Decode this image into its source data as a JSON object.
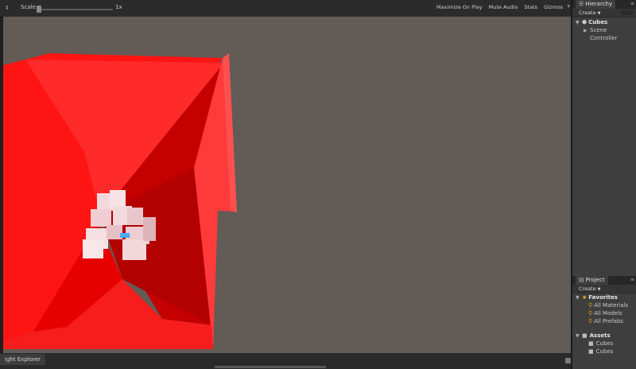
{
  "toolbar": {
    "scale_label": "Scale",
    "scale_value": "1x",
    "maximize_on_play": "Maximize On Play",
    "mute_audio": "Mute Audio",
    "stats": "Stats",
    "gizmos": "Gizmos"
  },
  "hierarchy": {
    "tab_label": "Hierarchy",
    "create_label": "Create",
    "scene_name": "Cubes",
    "items": [
      {
        "label": "Scene"
      },
      {
        "label": "Controller"
      }
    ]
  },
  "project": {
    "tab_label": "Project",
    "create_label": "Create",
    "favorites_label": "Favorites",
    "favorites": [
      {
        "label": "All Materials"
      },
      {
        "label": "All Models"
      },
      {
        "label": "All Prefabs"
      }
    ],
    "assets_label": "Assets",
    "assets": [
      {
        "label": "Cubes"
      },
      {
        "label": "Cubes"
      }
    ]
  },
  "bottom_tab": {
    "label": "ight Explorer"
  },
  "colors": {
    "viewport_background": "#625b56",
    "red_plane": "#ff1a1a",
    "cube_color": "#f4d8dc",
    "selection": "#3e5f96"
  }
}
